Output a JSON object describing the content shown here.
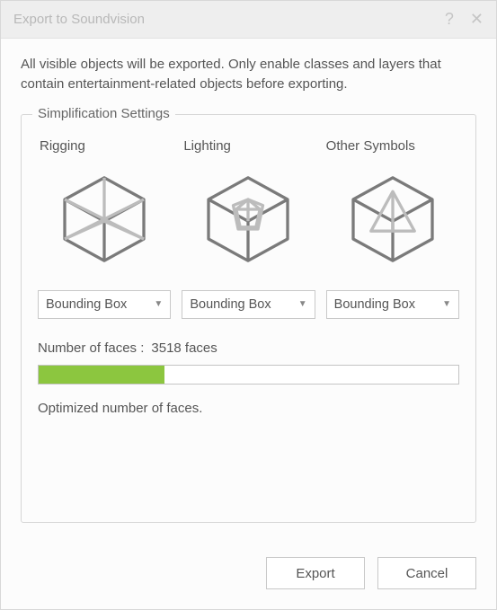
{
  "titlebar": {
    "title": "Export to Soundvision"
  },
  "intro": "All visible objects will be exported. Only enable  classes and layers that contain entertainment-related objects before exporting.",
  "fieldset": {
    "legend": "Simplification Settings",
    "columns": [
      {
        "header": "Rigging",
        "dropdown": "Bounding Box"
      },
      {
        "header": "Lighting",
        "dropdown": "Bounding Box"
      },
      {
        "header": "Other Symbols",
        "dropdown": "Bounding Box"
      }
    ],
    "faces": {
      "label": "Number of faces :",
      "value": "3518 faces"
    },
    "progress_percent": 30,
    "status": "Optimized number of faces."
  },
  "footer": {
    "export": "Export",
    "cancel": "Cancel"
  }
}
